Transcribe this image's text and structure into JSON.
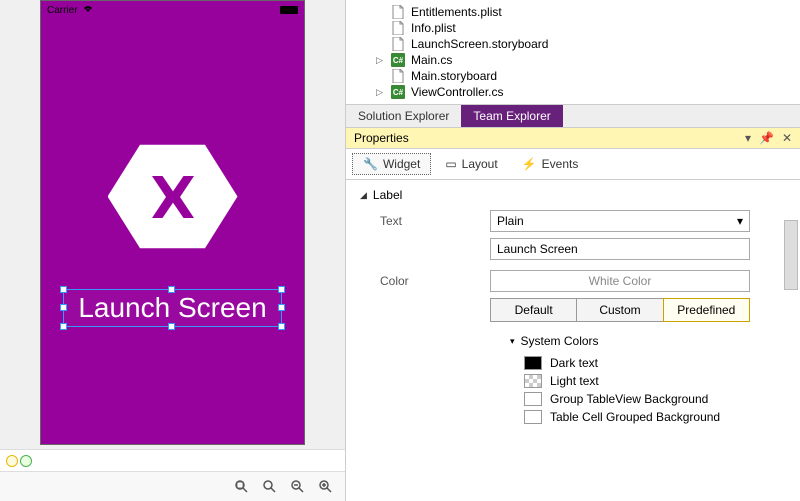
{
  "designer": {
    "carrier": "Carrier",
    "launch_text": "Launch Screen"
  },
  "tree": {
    "items": [
      {
        "icon": "file",
        "label": "Entitlements.plist",
        "arrow": false
      },
      {
        "icon": "file",
        "label": "Info.plist",
        "arrow": false
      },
      {
        "icon": "file",
        "label": "LaunchScreen.storyboard",
        "arrow": false
      },
      {
        "icon": "cs",
        "label": "Main.cs",
        "arrow": true
      },
      {
        "icon": "file",
        "label": "Main.storyboard",
        "arrow": false
      },
      {
        "icon": "cs",
        "label": "ViewController.cs",
        "arrow": true
      }
    ]
  },
  "tabs": {
    "solution": "Solution Explorer",
    "team": "Team Explorer"
  },
  "panel": {
    "title": "Properties",
    "widget": "Widget",
    "layout": "Layout",
    "events": "Events"
  },
  "props": {
    "group": "Label",
    "text_label": "Text",
    "text_type": "Plain",
    "text_value": "Launch Screen",
    "color_label": "Color",
    "color_value": "White Color",
    "seg": {
      "default": "Default",
      "custom": "Custom",
      "predefined": "Predefined"
    },
    "syscolors_label": "System Colors",
    "colors": [
      {
        "name": "Dark text",
        "swatch": "#000000"
      },
      {
        "name": "Light text",
        "swatch": "checker"
      },
      {
        "name": "Group TableView Background",
        "swatch": "#ffffff"
      },
      {
        "name": "Table Cell Grouped Background",
        "swatch": "#ffffff"
      }
    ]
  }
}
